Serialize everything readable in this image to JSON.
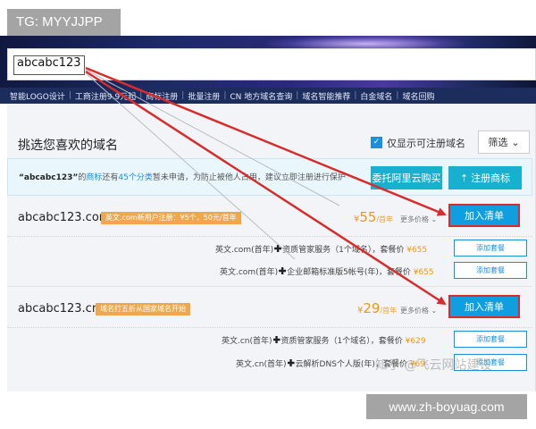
{
  "tg_badge": "TG: MYYJJPP",
  "search": {
    "value": "abcabc123"
  },
  "nav": {
    "items": [
      "智能LOGO设计",
      "工商注册9.9元起",
      "商标注册",
      "批量注册",
      "CN 地方域名查询",
      "域名智能推荐",
      "白金域名",
      "域名回购"
    ],
    "separator": "|"
  },
  "card": {
    "title": "挑选您喜欢的域名",
    "filter_check": "✓",
    "filter_label": "仅显示可注册域名",
    "sort_label": "筛选",
    "sort_chevron": "⌄"
  },
  "notice": {
    "quoted_domain": "“abcabc123”",
    "text_1": "的",
    "link_trademark": "商标",
    "text_2": "还有",
    "link_categories": "45个分类",
    "text_3": "暂未申请，为防止被他人占用，建议立即注册进行保护",
    "btn_entrust": "委托阿里云购买",
    "btn_register_icon": "⇡",
    "btn_register": "注册商标"
  },
  "domains": [
    {
      "name": "abcabc123.com",
      "promo": "英文.com新用户注册：¥5个，50元/首年",
      "price_symbol": "¥",
      "price": "55",
      "price_unit": "/首年",
      "more_price": "更多价格 ⌄",
      "add_label": "加入清单",
      "bundles": [
        {
          "prefix": "英文.com(首年)",
          "item": "资质管家服务（1个域名）",
          "mid": "，套餐价 ",
          "price": "¥655",
          "btn": "添加套餐"
        },
        {
          "prefix": "英文.com(首年)",
          "item": "企业邮箱标准版5帐号(年)",
          "mid": "，套餐价 ",
          "price": "¥655",
          "btn": "添加套餐"
        }
      ]
    },
    {
      "name": "abcabc123.cn",
      "promo": "域名打五折从国家域名开始",
      "price_symbol": "¥",
      "price": "29",
      "price_unit": "/首年",
      "more_price": "更多价格 ⌄",
      "add_label": "加入清单",
      "bundles": [
        {
          "prefix": "英文.cn(首年)",
          "item": "资质管家服务（1个域名）",
          "mid": "，套餐价 ",
          "price": "¥629",
          "btn": "添加套餐"
        },
        {
          "prefix": "英文.cn(首年)",
          "item": "云解析DNS个人版(年)",
          "mid": "，套餐价 ",
          "price": "¥69",
          "btn": "添加套餐"
        }
      ]
    }
  ],
  "watermark": "知乎 @飞云网站建设",
  "footer_badge": "www.zh-boyuag.com",
  "colors": {
    "accent_blue": "#0f9fe0",
    "teal": "#17b0cf",
    "price_orange": "#f39800",
    "arrow_red": "#d82c2c"
  }
}
